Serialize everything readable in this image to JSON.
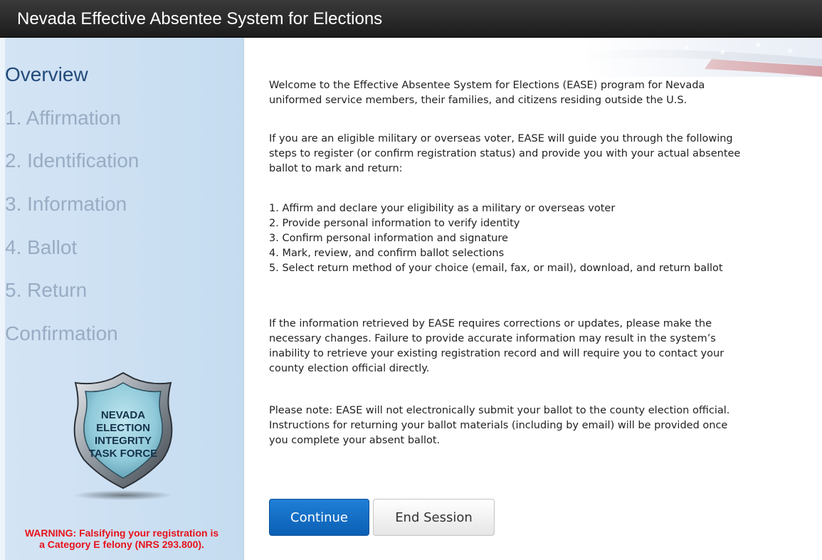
{
  "header": {
    "title": "Nevada Effective Absentee System for Elections"
  },
  "sidebar": {
    "items": [
      {
        "label": "Overview",
        "active": true
      },
      {
        "label": "1. Affirmation",
        "active": false
      },
      {
        "label": "2. Identification",
        "active": false
      },
      {
        "label": "3. Information",
        "active": false
      },
      {
        "label": "4. Ballot",
        "active": false
      },
      {
        "label": "5. Return",
        "active": false
      },
      {
        "label": "Confirmation",
        "active": false
      }
    ],
    "badge": {
      "line1": "NEVADA",
      "line2": "ELECTION",
      "line3": "INTEGRITY",
      "line4": "TASK FORCE"
    },
    "warning": {
      "line1": "WARNING: Falsifying your registration is",
      "line2": "a Category E felony (NRS 293.800)."
    }
  },
  "main": {
    "welcome_line1": "Welcome to the Effective Absentee System for Elections (EASE) program for Nevada",
    "welcome_line2": "uniformed service members, their families, and citizens residing outside the U.S.",
    "eligible_line1": "If you are an eligible military or overseas voter, EASE will guide you through the following",
    "eligible_line2": "steps to register (or confirm registration status) and provide you with your actual absentee",
    "eligible_line3": "ballot to mark and return:",
    "steps": [
      "1.  Affirm and declare your eligibility as a military or overseas voter",
      "2.  Provide personal information to verify identity",
      "3.  Confirm personal information and signature",
      "4.  Mark, review, and confirm ballot selections",
      "5.  Select return method of your choice (email, fax, or mail), download, and return ballot"
    ],
    "corrections_line1": "If the information retrieved by EASE requires corrections or updates, please make the",
    "corrections_line2": "necessary changes. Failure to provide accurate information may result in the system’s",
    "corrections_line3": "inability to retrieve your existing registration record and will require you to contact your",
    "corrections_line4": "county election official directly.",
    "note_line1": "Please note:  EASE will not electronically submit your ballot to the county election official.",
    "note_line2": "Instructions for returning your ballot materials (including by email) will be provided once",
    "note_line3": "you complete your absent ballot."
  },
  "buttons": {
    "continue_label": "Continue",
    "end_label": "End Session"
  },
  "colors": {
    "accent": "#0b5fb4",
    "sidebar_bg": "#cfe1f3",
    "warning": "#e8121b",
    "nav_active": "#234a7a",
    "nav_inactive": "#98acc3"
  }
}
